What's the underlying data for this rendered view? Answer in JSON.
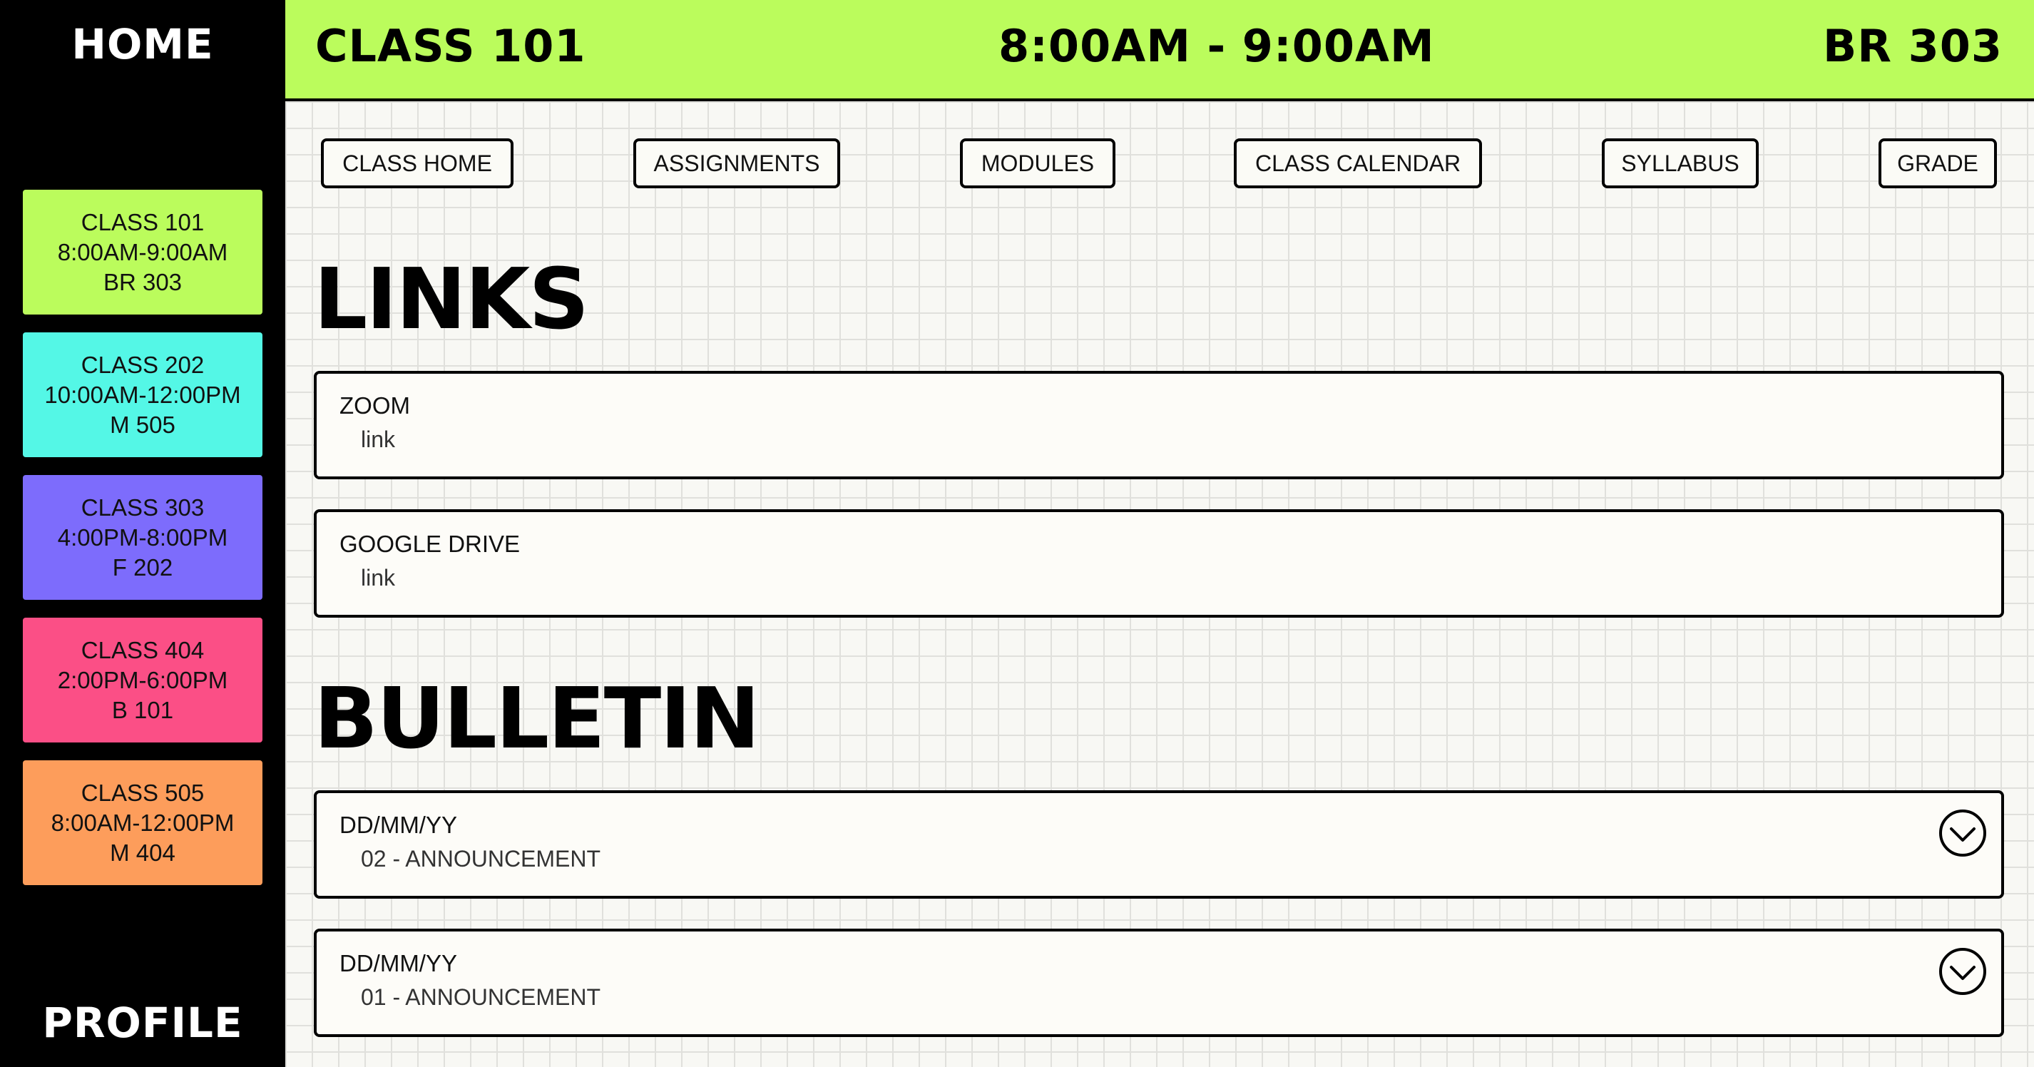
{
  "sidebar": {
    "home_label": "HOME",
    "profile_label": "PROFILE",
    "classes": [
      {
        "name": "CLASS 101",
        "time": "8:00AM-9:00AM",
        "room": "BR 303",
        "color": "#bbfc5c"
      },
      {
        "name": "CLASS 202",
        "time": "10:00AM-12:00PM",
        "room": "M 505",
        "color": "#54f7e6"
      },
      {
        "name": "CLASS 303",
        "time": "4:00PM-8:00PM",
        "room": "F 202",
        "color": "#7d6cfc"
      },
      {
        "name": "CLASS 404",
        "time": "2:00PM-6:00PM",
        "room": "B 101",
        "color": "#fb4f86"
      },
      {
        "name": "CLASS 505",
        "time": "8:00AM-12:00PM",
        "room": "M 404",
        "color": "#fd9d5b"
      }
    ]
  },
  "header": {
    "class_name": "CLASS 101",
    "time": "8:00AM - 9:00AM",
    "room": "BR 303",
    "color": "#bbfc5c"
  },
  "nav": [
    {
      "label": "CLASS HOME"
    },
    {
      "label": "ASSIGNMENTS"
    },
    {
      "label": "MODULES"
    },
    {
      "label": "CLASS CALENDAR"
    },
    {
      "label": "SYLLABUS"
    },
    {
      "label": "GRADE"
    }
  ],
  "links": {
    "title": "LINKS",
    "items": [
      {
        "title": "ZOOM",
        "sub": "link"
      },
      {
        "title": "GOOGLE DRIVE",
        "sub": "link"
      }
    ]
  },
  "bulletin": {
    "title": "BULLETIN",
    "items": [
      {
        "date": "DD/MM/YY",
        "text": "02 - ANNOUNCEMENT",
        "icon": "chevron-down-circle-icon"
      },
      {
        "date": "DD/MM/YY",
        "text": "01 - ANNOUNCEMENT",
        "icon": "chevron-down-circle-icon"
      }
    ]
  }
}
